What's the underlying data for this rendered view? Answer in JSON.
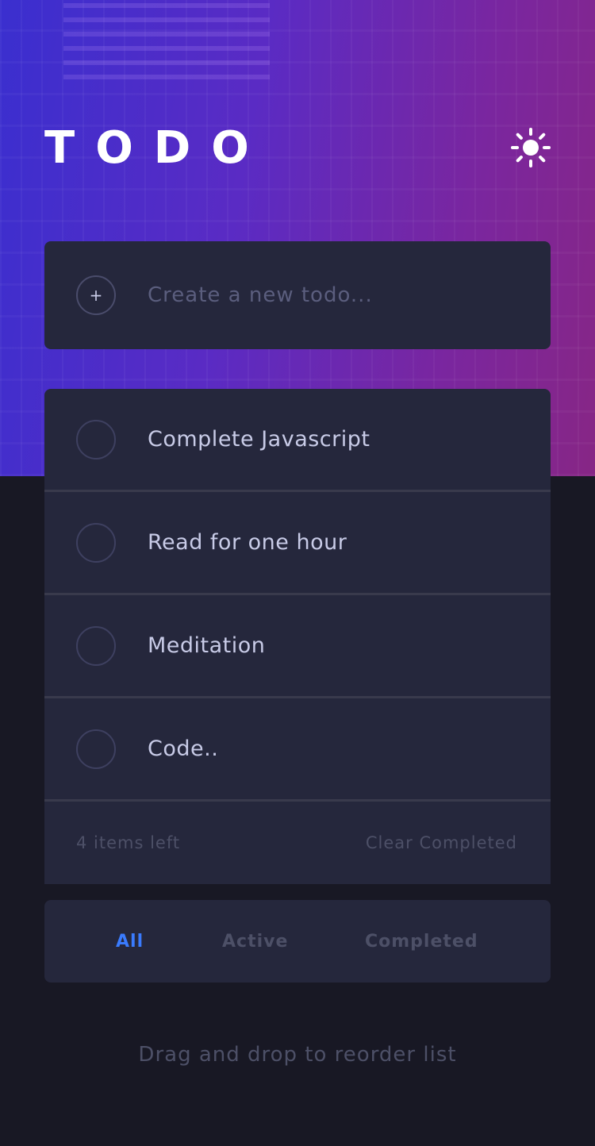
{
  "app": {
    "title": "TODO",
    "theme_toggle_icon": "sun-icon"
  },
  "create": {
    "placeholder": "Create a new todo...",
    "add_icon": "plus-icon"
  },
  "todos": [
    {
      "text": "Complete Javascript",
      "completed": false
    },
    {
      "text": "Read for one hour",
      "completed": false
    },
    {
      "text": "Meditation",
      "completed": false
    },
    {
      "text": "Code..",
      "completed": false
    }
  ],
  "footer": {
    "items_left": "4 items left",
    "clear_label": "Clear Completed"
  },
  "filters": {
    "all": "All",
    "active": "Active",
    "completed": "Completed",
    "selected": "All"
  },
  "hint": "Drag and drop to reorder list",
  "colors": {
    "accent": "#3a7bfd",
    "card": "#25273c",
    "background": "#181824"
  }
}
